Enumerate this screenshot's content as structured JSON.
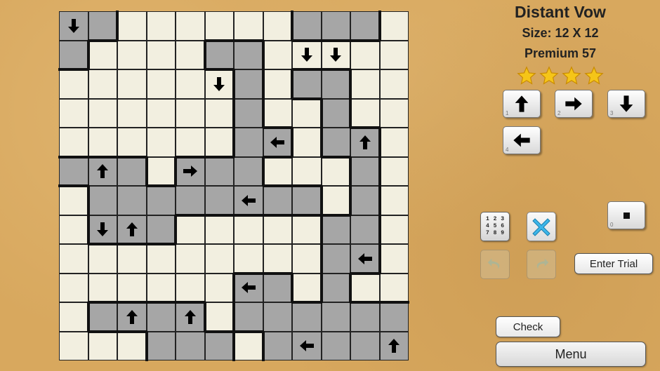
{
  "header": {
    "title": "Distant Vow",
    "size": "Size: 12 X 12",
    "level": "Premium 57",
    "stars": 4
  },
  "grid": {
    "rows": 12,
    "cols": 12,
    "shading": [
      "GGWWWWWWGGGW",
      "GWWWWGGWWWWW",
      "WWWWWWGWGGWW",
      "WWWWWWGWWGWW",
      "WWWWWWGGWGGW",
      "GGGWGGGWWWGW",
      "WGGGGGGGGWGW",
      "WGGGWWWWWGGW",
      "WWWWWWWWWGGW",
      "WWWWWWGGWGWW",
      "WGGGGWGGGGGG",
      "WWWGGGWGGGGG"
    ],
    "arrows": [
      {
        "r": 0,
        "c": 0,
        "dir": "down"
      },
      {
        "r": 1,
        "c": 8,
        "dir": "down"
      },
      {
        "r": 1,
        "c": 9,
        "dir": "down"
      },
      {
        "r": 2,
        "c": 5,
        "dir": "down"
      },
      {
        "r": 4,
        "c": 7,
        "dir": "left"
      },
      {
        "r": 4,
        "c": 10,
        "dir": "up"
      },
      {
        "r": 5,
        "c": 1,
        "dir": "up"
      },
      {
        "r": 5,
        "c": 4,
        "dir": "right"
      },
      {
        "r": 6,
        "c": 6,
        "dir": "left"
      },
      {
        "r": 7,
        "c": 1,
        "dir": "down"
      },
      {
        "r": 7,
        "c": 2,
        "dir": "up"
      },
      {
        "r": 8,
        "c": 10,
        "dir": "left"
      },
      {
        "r": 9,
        "c": 6,
        "dir": "left"
      },
      {
        "r": 10,
        "c": 2,
        "dir": "up"
      },
      {
        "r": 10,
        "c": 4,
        "dir": "up"
      },
      {
        "r": 11,
        "c": 8,
        "dir": "left"
      },
      {
        "r": 11,
        "c": 11,
        "dir": "up"
      }
    ]
  },
  "keypad": [
    {
      "num": "1",
      "dir": "up"
    },
    {
      "num": "2",
      "dir": "right"
    },
    {
      "num": "3",
      "dir": "down"
    },
    {
      "num": "4",
      "dir": "left"
    }
  ],
  "clear_key_num": "0",
  "candidates_digits": "1 2 3 4 5 6 7 8 9",
  "buttons": {
    "enter_trial": "Enter Trial",
    "check": "Check",
    "menu": "Menu"
  },
  "colors": {
    "background": "#d8a85e",
    "white_cell": "#f2efe0",
    "gray_cell": "#a6a6a6",
    "region_border": "#111111",
    "star": "#f5c518",
    "x_icon": "#3db7ea"
  }
}
